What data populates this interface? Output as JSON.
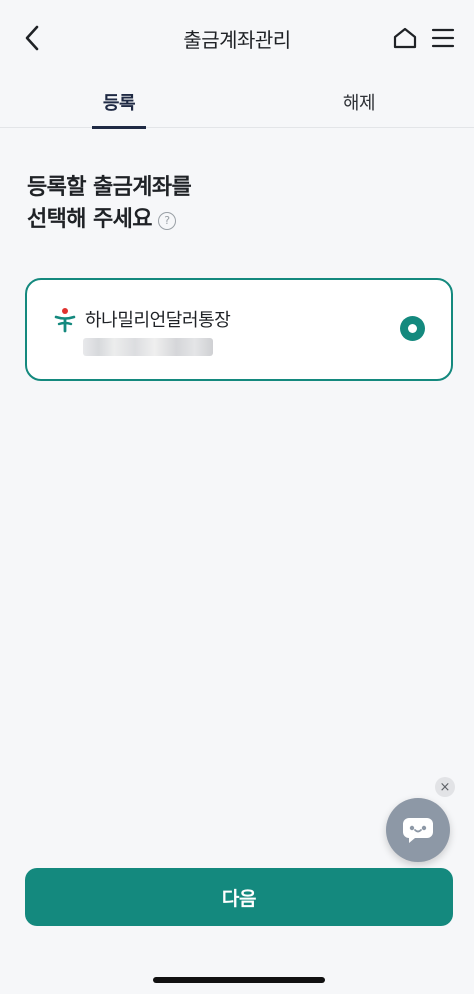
{
  "header": {
    "title": "출금계좌관리",
    "back_icon": "chevron-left-icon",
    "home_icon": "home-icon",
    "menu_icon": "hamburger-menu-icon"
  },
  "tabs": [
    {
      "label": "등록",
      "active": true
    },
    {
      "label": "해제",
      "active": false
    }
  ],
  "heading": {
    "line1": "등록할 출금계좌를",
    "line2": "선택해 주세요",
    "help_symbol": "?"
  },
  "account": {
    "name": "하나밀리언달러통장",
    "selected": true,
    "number_masked": true
  },
  "chatbot": {
    "close_symbol": "×"
  },
  "next_button": {
    "label": "다음"
  },
  "colors": {
    "accent": "#14897e",
    "tab_active": "#1f2a44",
    "background": "#f6f7f9",
    "chatbot": "#8d98a6"
  }
}
